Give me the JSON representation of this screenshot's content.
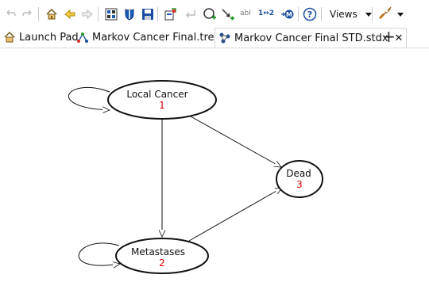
{
  "toolbar": {
    "views_label": "Views",
    "abl_label": "abl",
    "seq_label": "1↔2",
    "m_label": "M",
    "help_label": "?",
    "icons": [
      "undo-icon",
      "redo-icon",
      "home-icon",
      "back-icon",
      "forward-icon",
      "image-icon",
      "shield-icon",
      "save-icon",
      "export-icon",
      "undo-arrow-icon",
      "add-node-icon",
      "add-arrow-icon",
      "text-icon",
      "sequence-icon",
      "markov-icon",
      "help-icon",
      "views-dropdown",
      "rocket-icon"
    ]
  },
  "tabs": [
    {
      "label": "Launch Pad",
      "icon": "home-icon"
    },
    {
      "label": "Markov Cancer Final.trex",
      "icon": "tree-icon"
    },
    {
      "label": "Markov Cancer Final STD.stdx",
      "icon": "diagram-icon",
      "active": true
    }
  ],
  "add_tab_label": "+",
  "close_tab_label": "✕",
  "diagram": {
    "nodes": [
      {
        "id": "local",
        "name": "Local Cancer",
        "num": "1",
        "self_loop": true
      },
      {
        "id": "meta",
        "name": "Metastases",
        "num": "2",
        "self_loop": true
      },
      {
        "id": "dead",
        "name": "Dead",
        "num": "3",
        "self_loop": false
      }
    ],
    "edges": [
      {
        "from": "local",
        "to": "meta"
      },
      {
        "from": "local",
        "to": "dead"
      },
      {
        "from": "meta",
        "to": "dead"
      }
    ],
    "number_color": "#e00000"
  }
}
